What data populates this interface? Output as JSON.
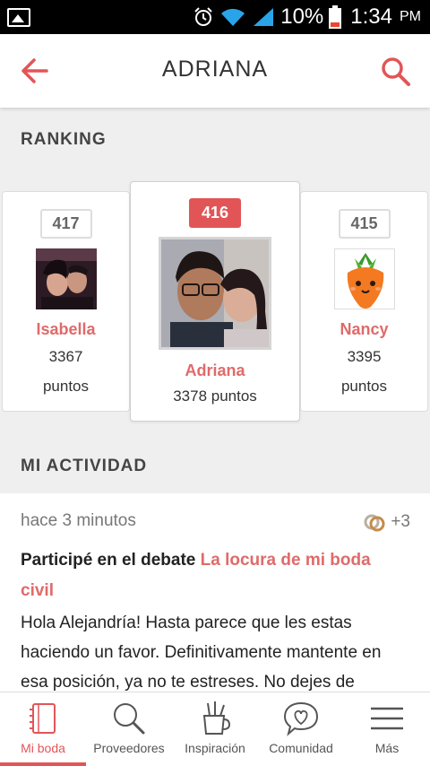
{
  "status_bar": {
    "battery_text": "10%",
    "time": "1:34",
    "ampm": "PM"
  },
  "header": {
    "title": "ADRIANA"
  },
  "ranking": {
    "title": "RANKING",
    "cards": [
      {
        "rank": "417",
        "name": "Isabella",
        "points_value": "3367",
        "points_label": "puntos"
      },
      {
        "rank": "416",
        "name": "Adriana",
        "points": "3378 puntos"
      },
      {
        "rank": "415",
        "name": "Nancy",
        "points_value": "3395",
        "points_label": "puntos"
      }
    ]
  },
  "activity": {
    "title": "MI ACTIVIDAD",
    "time": "hace 3 minutos",
    "extra_count": "+3",
    "headline_prefix": "Participé en el debate",
    "headline_link": "La locura de mi boda civil",
    "body": "Hola Alejandría! Hasta parece que les estas haciendo un favor. Definitivamente mantente en esa posición, ya no te estreses. No dejes de"
  },
  "bottom_nav": [
    {
      "label": "Mi boda",
      "icon": "notebook-icon",
      "active": true
    },
    {
      "label": "Proveedores",
      "icon": "search-icon"
    },
    {
      "label": "Inspiración",
      "icon": "pencil-cup-icon"
    },
    {
      "label": "Comunidad",
      "icon": "heart-chat-icon"
    },
    {
      "label": "Más",
      "icon": "menu-icon"
    }
  ],
  "colors": {
    "accent": "#e25557",
    "name_color": "#e06a6a"
  }
}
